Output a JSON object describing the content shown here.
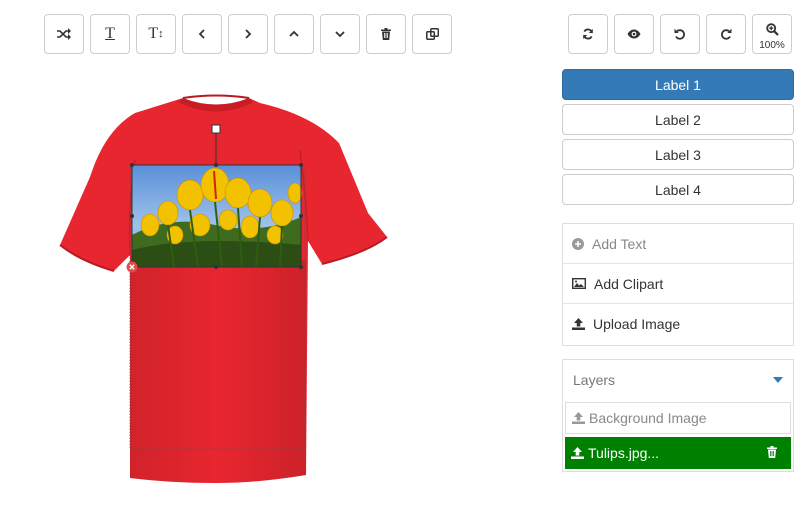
{
  "toolbar": {
    "left_buttons": [
      "shuffle-icon",
      "text-icon",
      "text-size-icon",
      "chevron-left-icon",
      "chevron-right-icon",
      "chevron-up-icon",
      "chevron-down-icon",
      "trash-icon",
      "duplicate-icon"
    ],
    "right_buttons": [
      "refresh-icon",
      "eye-icon",
      "undo-icon",
      "redo-icon",
      "zoom-in-icon"
    ],
    "zoom_level": "100%",
    "text_glyph": "T",
    "text_size_glyph": "T",
    "text_size_mark": "↕"
  },
  "labels": {
    "items": [
      "Label 1",
      "Label 2",
      "Label 3",
      "Label 4"
    ],
    "active_index": 0
  },
  "add_panel": {
    "add_text": "Add Text",
    "add_clipart": "Add Clipart",
    "upload_image": "Upload Image"
  },
  "layers": {
    "title": "Layers",
    "items": [
      "Background Image",
      "Tulips.jpg..."
    ],
    "selected_index": 1
  },
  "canvas": {
    "shirt_color": "#e8262f",
    "image_name": "Tulips.jpg"
  },
  "colors": {
    "primary": "#337ab7",
    "selected_layer": "#008000",
    "shirt": "#e8262f"
  }
}
